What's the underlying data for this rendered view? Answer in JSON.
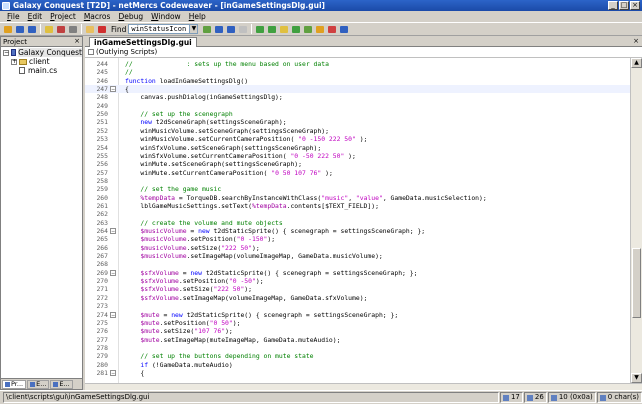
{
  "window": {
    "title": "Galaxy Conquest [T2D] - netMercs Codeweaver - [inGameSettingsDlg.gui]",
    "buttons": [
      "_",
      "□",
      "×"
    ]
  },
  "menu": [
    {
      "label": "File",
      "u": "F",
      "rest": "ile"
    },
    {
      "label": "Edit",
      "u": "E",
      "rest": "dit"
    },
    {
      "label": "Project",
      "u": "P",
      "rest": "roject"
    },
    {
      "label": "Macros",
      "u": "M",
      "rest": "acros"
    },
    {
      "label": "Debug",
      "u": "D",
      "rest": "ebug"
    },
    {
      "label": "Window",
      "u": "W",
      "rest": "indow"
    },
    {
      "label": "Help",
      "u": "H",
      "rest": "elp"
    }
  ],
  "toolbar": {
    "find_label": "Find",
    "find_value": "winStatusIcon",
    "icon_colors": [
      "#e0a020",
      "#3060c0",
      "#3060c0",
      "#e0c040",
      "#c04040",
      "#808080",
      "#e8c060",
      "#d03030",
      "#60a040",
      "#3060c0",
      "#3060c0",
      "#c0c0c0",
      "#40a040",
      "#40a040",
      "#e0c040",
      "#40a040",
      "#60a040",
      "#e0a020",
      "#d04040",
      "#3060c0"
    ]
  },
  "project_panel": {
    "header": "Project",
    "close": "×",
    "tree": [
      {
        "label": "Galaxy Conquest",
        "kind": "project",
        "depth": 0,
        "exp": "−"
      },
      {
        "label": "client",
        "kind": "folder",
        "depth": 1,
        "exp": "+"
      },
      {
        "label": "main.cs",
        "kind": "file",
        "depth": 1,
        "exp": ""
      }
    ],
    "tabs": [
      "Pr...",
      "E...",
      "E..."
    ]
  },
  "editor": {
    "tab_label": "inGameSettingsDlg.gui",
    "close": "×",
    "scope": "(Outlying Scripts)",
    "lines": [
      {
        "n": "244",
        "fold": "",
        "caret": false,
        "segs": [
          [
            "c",
            "//              : sets up the menu based on user data"
          ]
        ]
      },
      {
        "n": "245",
        "fold": "",
        "caret": false,
        "segs": [
          [
            "c",
            "//"
          ]
        ]
      },
      {
        "n": "246",
        "fold": "",
        "caret": false,
        "segs": [
          [
            "k",
            "function"
          ],
          [
            "n",
            " loadInGameSettingsDlg()"
          ]
        ]
      },
      {
        "n": "247",
        "fold": "box",
        "caret": true,
        "segs": [
          [
            "n",
            "{"
          ]
        ]
      },
      {
        "n": "248",
        "fold": "",
        "caret": false,
        "segs": [
          [
            "n",
            "    canvas.pushDialog(inGameSettingsDlg);"
          ]
        ]
      },
      {
        "n": "249",
        "fold": "",
        "caret": false,
        "segs": [
          [
            "n",
            ""
          ]
        ]
      },
      {
        "n": "250",
        "fold": "",
        "caret": false,
        "segs": [
          [
            "c",
            "    // set up the scenegraph"
          ]
        ]
      },
      {
        "n": "251",
        "fold": "",
        "caret": false,
        "segs": [
          [
            "n",
            "    "
          ],
          [
            "k",
            "new"
          ],
          [
            "n",
            " t2dSceneGraph(settingsSceneGraph);"
          ]
        ]
      },
      {
        "n": "252",
        "fold": "",
        "caret": false,
        "segs": [
          [
            "n",
            "    winMusicVolume.setSceneGraph(settingsSceneGraph);"
          ]
        ]
      },
      {
        "n": "253",
        "fold": "",
        "caret": false,
        "segs": [
          [
            "n",
            "    winMusicVolume.setCurrentCameraPosition( "
          ],
          [
            "s",
            "\"0 -150 222 50\""
          ],
          [
            "n",
            " );"
          ]
        ]
      },
      {
        "n": "254",
        "fold": "",
        "caret": false,
        "segs": [
          [
            "n",
            "    winSfxVolume.setSceneGraph(settingsSceneGraph);"
          ]
        ]
      },
      {
        "n": "255",
        "fold": "",
        "caret": false,
        "segs": [
          [
            "n",
            "    winSfxVolume.setCurrentCameraPosition( "
          ],
          [
            "s",
            "\"0 -50 222 50\""
          ],
          [
            "n",
            " );"
          ]
        ]
      },
      {
        "n": "256",
        "fold": "",
        "caret": false,
        "segs": [
          [
            "n",
            "    winMute.setSceneGraph(settingsSceneGraph);"
          ]
        ]
      },
      {
        "n": "257",
        "fold": "",
        "caret": false,
        "segs": [
          [
            "n",
            "    winMute.setCurrentCameraPosition( "
          ],
          [
            "s",
            "\"0 50 107 76\""
          ],
          [
            "n",
            " );"
          ]
        ]
      },
      {
        "n": "258",
        "fold": "",
        "caret": false,
        "segs": [
          [
            "n",
            ""
          ]
        ]
      },
      {
        "n": "259",
        "fold": "",
        "caret": false,
        "segs": [
          [
            "c",
            "    // set the game music"
          ]
        ]
      },
      {
        "n": "260",
        "fold": "",
        "caret": false,
        "segs": [
          [
            "n",
            "    "
          ],
          [
            "v",
            "%tempData"
          ],
          [
            "n",
            " = TorqueDB.searchByInstanceWithClass("
          ],
          [
            "s",
            "\"music\""
          ],
          [
            "n",
            ", "
          ],
          [
            "s",
            "\"value\""
          ],
          [
            "n",
            ", GameData.musicSelection);"
          ]
        ]
      },
      {
        "n": "261",
        "fold": "",
        "caret": false,
        "segs": [
          [
            "n",
            "    lblGameMusicSettings.setText("
          ],
          [
            "v",
            "%tempData"
          ],
          [
            "n",
            ".contents[$TEXT_FIELD]);"
          ]
        ]
      },
      {
        "n": "262",
        "fold": "",
        "caret": false,
        "segs": [
          [
            "n",
            ""
          ]
        ]
      },
      {
        "n": "263",
        "fold": "",
        "caret": false,
        "segs": [
          [
            "c",
            "    // create the volume and mute objects"
          ]
        ]
      },
      {
        "n": "264",
        "fold": "box",
        "caret": false,
        "segs": [
          [
            "n",
            "    "
          ],
          [
            "v",
            "$musicVolume"
          ],
          [
            "n",
            " = "
          ],
          [
            "k",
            "new"
          ],
          [
            "n",
            " t2dStaticSprite() { scenegraph = settingsSceneGraph; };"
          ]
        ]
      },
      {
        "n": "265",
        "fold": "",
        "caret": false,
        "segs": [
          [
            "n",
            "    "
          ],
          [
            "v",
            "$musicVolume"
          ],
          [
            "n",
            ".setPosition("
          ],
          [
            "s",
            "\"0 -150\""
          ],
          [
            "n",
            ");"
          ]
        ]
      },
      {
        "n": "266",
        "fold": "",
        "caret": false,
        "segs": [
          [
            "n",
            "    "
          ],
          [
            "v",
            "$musicVolume"
          ],
          [
            "n",
            ".setSize("
          ],
          [
            "s",
            "\"222 50\""
          ],
          [
            "n",
            ");"
          ]
        ]
      },
      {
        "n": "267",
        "fold": "",
        "caret": false,
        "segs": [
          [
            "n",
            "    "
          ],
          [
            "v",
            "$musicVolume"
          ],
          [
            "n",
            ".setImageMap(volumeImageMap, GameData.musicVolume);"
          ]
        ]
      },
      {
        "n": "268",
        "fold": "",
        "caret": false,
        "segs": [
          [
            "n",
            ""
          ]
        ]
      },
      {
        "n": "269",
        "fold": "box",
        "caret": false,
        "segs": [
          [
            "n",
            "    "
          ],
          [
            "v",
            "$sfxVolume"
          ],
          [
            "n",
            " = "
          ],
          [
            "k",
            "new"
          ],
          [
            "n",
            " t2dStaticSprite() { scenegraph = settingsSceneGraph; };"
          ]
        ]
      },
      {
        "n": "270",
        "fold": "",
        "caret": false,
        "segs": [
          [
            "n",
            "    "
          ],
          [
            "v",
            "$sfxVolume"
          ],
          [
            "n",
            ".setPosition("
          ],
          [
            "s",
            "\"0 -50\""
          ],
          [
            "n",
            ");"
          ]
        ]
      },
      {
        "n": "271",
        "fold": "",
        "caret": false,
        "segs": [
          [
            "n",
            "    "
          ],
          [
            "v",
            "$sfxVolume"
          ],
          [
            "n",
            ".setSize("
          ],
          [
            "s",
            "\"222 50\""
          ],
          [
            "n",
            ");"
          ]
        ]
      },
      {
        "n": "272",
        "fold": "",
        "caret": false,
        "segs": [
          [
            "n",
            "    "
          ],
          [
            "v",
            "$sfxVolume"
          ],
          [
            "n",
            ".setImageMap(volumeImageMap, GameData.sfxVolume);"
          ]
        ]
      },
      {
        "n": "273",
        "fold": "",
        "caret": false,
        "segs": [
          [
            "n",
            ""
          ]
        ]
      },
      {
        "n": "274",
        "fold": "box",
        "caret": false,
        "segs": [
          [
            "n",
            "    "
          ],
          [
            "v",
            "$mute"
          ],
          [
            "n",
            " = "
          ],
          [
            "k",
            "new"
          ],
          [
            "n",
            " t2dStaticSprite() { scenegraph = settingsSceneGraph; };"
          ]
        ]
      },
      {
        "n": "275",
        "fold": "",
        "caret": false,
        "segs": [
          [
            "n",
            "    "
          ],
          [
            "v",
            "$mute"
          ],
          [
            "n",
            ".setPosition("
          ],
          [
            "s",
            "\"0 50\""
          ],
          [
            "n",
            ");"
          ]
        ]
      },
      {
        "n": "276",
        "fold": "",
        "caret": false,
        "segs": [
          [
            "n",
            "    "
          ],
          [
            "v",
            "$mute"
          ],
          [
            "n",
            ".setSize("
          ],
          [
            "s",
            "\"107 76\""
          ],
          [
            "n",
            ");"
          ]
        ]
      },
      {
        "n": "277",
        "fold": "",
        "caret": false,
        "segs": [
          [
            "n",
            "    "
          ],
          [
            "v",
            "$mute"
          ],
          [
            "n",
            ".setImageMap(muteImageMap, GameData.muteAudio);"
          ]
        ]
      },
      {
        "n": "278",
        "fold": "",
        "caret": false,
        "segs": [
          [
            "n",
            ""
          ]
        ]
      },
      {
        "n": "279",
        "fold": "",
        "caret": false,
        "segs": [
          [
            "c",
            "    // set up the buttons depending on mute state"
          ]
        ]
      },
      {
        "n": "280",
        "fold": "",
        "caret": false,
        "segs": [
          [
            "n",
            "    "
          ],
          [
            "k",
            "if"
          ],
          [
            "n",
            " (!GameData.muteAudio)"
          ]
        ]
      },
      {
        "n": "281",
        "fold": "box",
        "caret": false,
        "segs": [
          [
            "n",
            "    {"
          ]
        ]
      }
    ]
  },
  "statusbar": {
    "path": "\\client\\scripts\\gui\\inGameSettingsDlg.gui",
    "line": "17",
    "col": "26",
    "lines": "10 (0x0a)",
    "chars": "0 char(s)"
  },
  "colors": {
    "comment": "#008000",
    "keyword": "#0000ff",
    "variable": "#a000a0",
    "string": "#c000c0",
    "titlebar": "#1b4aa8"
  }
}
